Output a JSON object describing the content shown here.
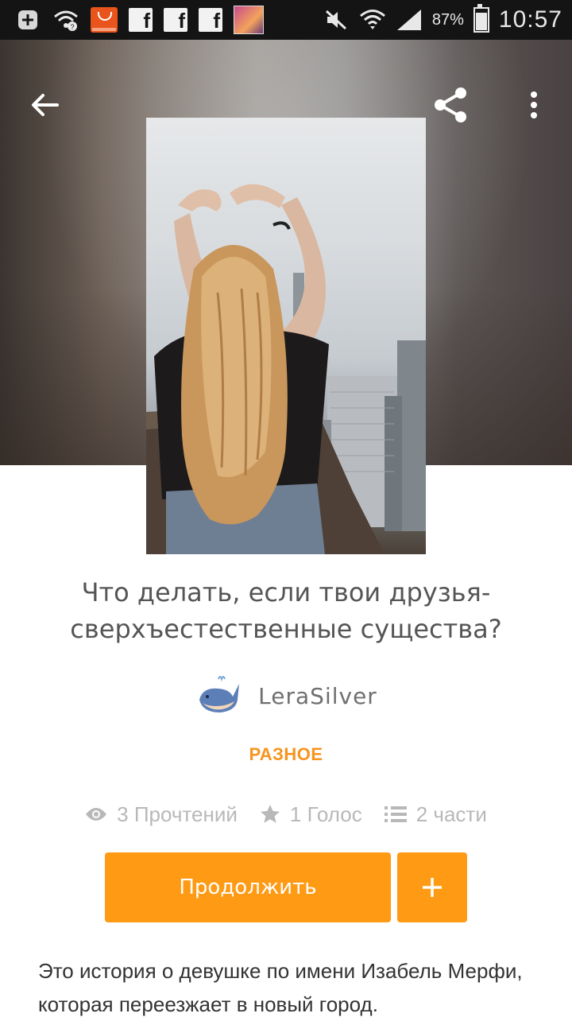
{
  "status_bar": {
    "battery_percent": "87%",
    "time": "10:57",
    "notification_icons": [
      "add-box-icon",
      "wifi-question-icon",
      "aliexpress-icon",
      "facebook-icon",
      "facebook-icon",
      "facebook-icon",
      "thumbnail-icon"
    ],
    "status_icons": [
      "mute-icon",
      "wifi-icon",
      "signal-icon",
      "battery-icon"
    ]
  },
  "toolbar": {
    "back_icon": "arrow-left-icon",
    "share_icon": "share-icon",
    "more_icon": "more-vertical-icon"
  },
  "story": {
    "title": "Что делать, если твои друзья-сверхъестественные существа?",
    "author": "LeraSilver",
    "category": "РАЗНОЕ",
    "reads": "3 Прочтений",
    "votes": "1 Голос",
    "parts": "2 части",
    "description": "Это история о девушке по имени Изабель Мерфи, которая переезжает в новый город."
  },
  "actions": {
    "continue_label": "Продолжить",
    "add_label": "+"
  },
  "colors": {
    "accent": "#ff9a14",
    "category": "#f7941d",
    "stat_gray": "#b8b8b8",
    "title_gray": "#555555"
  }
}
